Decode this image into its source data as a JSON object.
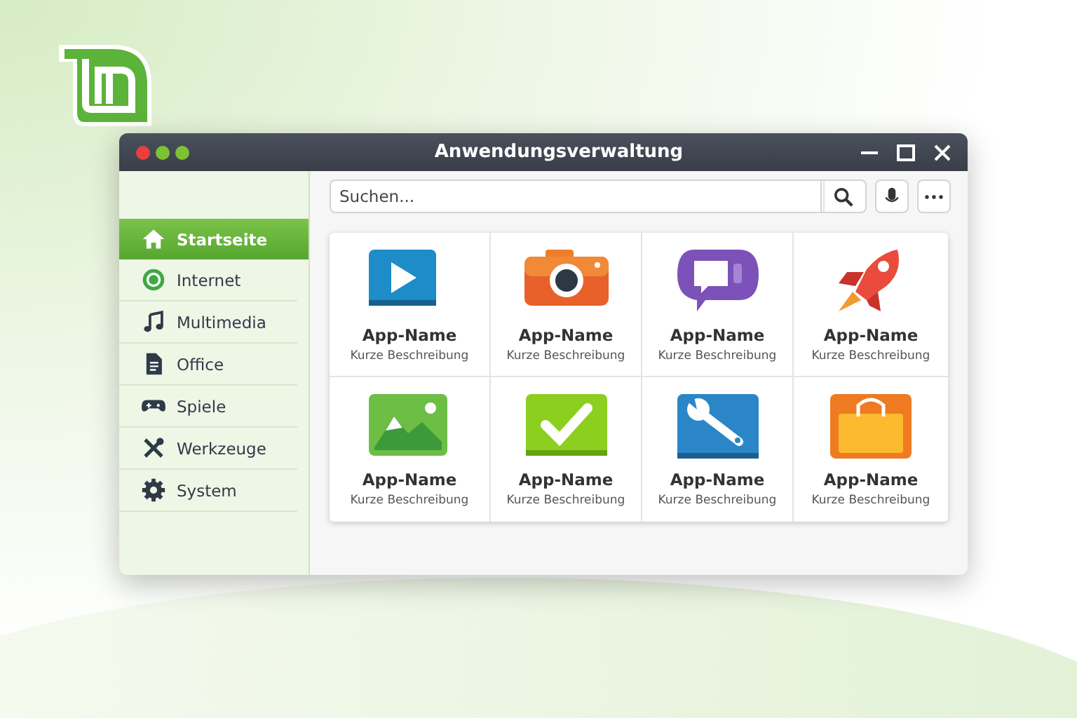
{
  "window": {
    "title": "Anwendungsverwaltung",
    "dots": [
      {
        "color": "#e9403d"
      },
      {
        "color": "#7cc232"
      },
      {
        "color": "#7cc232"
      }
    ]
  },
  "search": {
    "placeholder": "Suchen..."
  },
  "sidebar": {
    "items": [
      {
        "label": "Startseite",
        "kind": "home",
        "selected": true
      },
      {
        "label": "Internet",
        "kind": "globe",
        "selected": false
      },
      {
        "label": "Multimedia",
        "kind": "music",
        "selected": false
      },
      {
        "label": "Office",
        "kind": "document",
        "selected": false
      },
      {
        "label": "Spiele",
        "kind": "gamepad",
        "selected": false
      },
      {
        "label": "Werkzeuge",
        "kind": "tools",
        "selected": false
      },
      {
        "label": "System",
        "kind": "gear",
        "selected": false
      }
    ]
  },
  "apps": [
    {
      "name": "App-Name",
      "description": "Kurze Beschreibung",
      "kind": "play"
    },
    {
      "name": "App-Name",
      "description": "Kurze Beschreibung",
      "kind": "camera"
    },
    {
      "name": "App-Name",
      "description": "Kurze Beschreibung",
      "kind": "chat"
    },
    {
      "name": "App-Name",
      "description": "Kurze Beschreibung",
      "kind": "rocket"
    },
    {
      "name": "App-Name",
      "description": "Kurze Beschreibung",
      "kind": "image"
    },
    {
      "name": "App-Name",
      "description": "Kurze Beschreibung",
      "kind": "check"
    },
    {
      "name": "App-Name",
      "description": "Kurze Beschreibung",
      "kind": "wrench"
    },
    {
      "name": "App-Name",
      "description": "Kurze Beschreibung",
      "kind": "bag"
    }
  ]
}
